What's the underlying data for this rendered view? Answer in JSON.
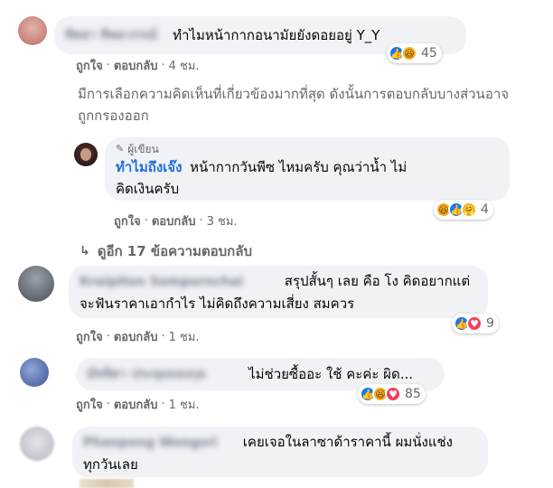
{
  "comments": [
    {
      "author": "ทิตยา ทิพยวรรณ์",
      "text": "ทำไมหน้ากากอนามัยยังดอยอยู่ Y_Y",
      "like": "ถูกใจ",
      "reply": "ตอบกลับ",
      "time": "4 ชม.",
      "reaction_count": "45",
      "avatar_color": "#c9837b"
    },
    {
      "author": "Kraipiton Sompornchai",
      "text_line1": "สรุปสั้นๆ เลย คือ โง คิดอยากแต่",
      "text_line2": "จะฟันราคาเอากำไร ไม่คิดถึงความเสี่ยง สมควร",
      "like": "ถูกใจ",
      "reply": "ตอบกลับ",
      "time": "1 ชม.",
      "reaction_count": "9",
      "avatar_color": "#6b6f78"
    },
    {
      "author": "มัทลิตา ประจุมมองกุล",
      "text": "ไม่ช่วยซื้ออะ ใช้ คะค่ะ ผิด...",
      "like": "ถูกใจ",
      "reply": "ตอบกลับ",
      "time": "1 ชม.",
      "reaction_count": "85",
      "avatar_color": "#4f67a8"
    },
    {
      "author": "Phanpong Wongsri",
      "text_line1": "เคยเจอในลาซาด้าราคานี้ ผมนั่งแช่ง",
      "text_line2": "ทุกวันเลย",
      "avatar_color": "#cfcfd4"
    }
  ],
  "notice": "มีการเลือกความคิดเห็นที่เกี่ยวข้องมากที่สุด ดังนั้นการตอบกลับบางส่วนอาจถูกกรองออก",
  "author_reply": {
    "badge": "ผู้เขียน",
    "author": "ทำไมถึงเจ๊ง",
    "text_inline": "หน้ากากวันพีซ ไหมครับ คุณว่าน้ำ ไม่",
    "text_line2": "คิดเงินครับ",
    "like": "ถูกใจ",
    "reply": "ตอบกลับ",
    "time": "3 ชม.",
    "reaction_count": "4"
  },
  "more_replies": "ดูอีก 17 ข้อความตอบกลับ",
  "colors": {
    "like_blue": "#1877f2",
    "haha_yellow": "#f7b125",
    "love_red": "#f33e58",
    "link_blue": "#216fdb",
    "bubble_bg": "#f0f2f5",
    "meta_gray": "#65676b"
  }
}
